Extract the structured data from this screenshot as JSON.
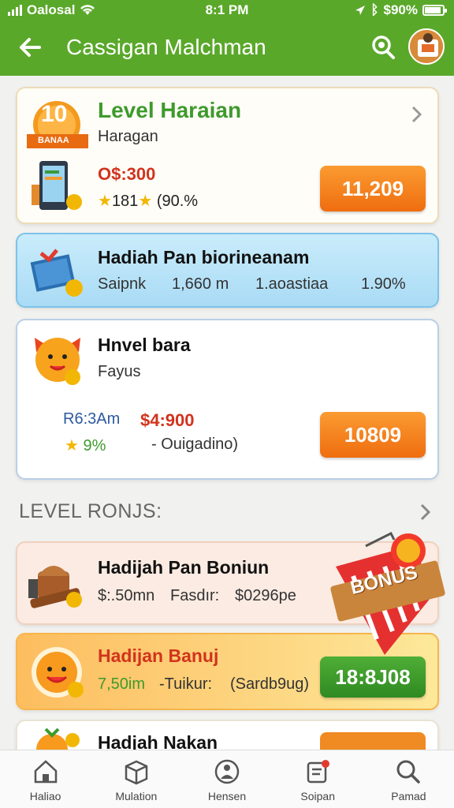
{
  "status": {
    "carrier": "Oalosal",
    "time": "8:1 PM",
    "battery": "$90%"
  },
  "header": {
    "title": "Cassigan Malchman"
  },
  "card1": {
    "badge_num": "10",
    "badge_text": "BANAA",
    "title": "Level Haraian",
    "subtitle": "Haragan",
    "price": "O$:300",
    "rating": "181",
    "rating_pct": "(90.%",
    "button": "11,209"
  },
  "card2": {
    "title": "Hadiah Pan biorineanam",
    "col1": "Saipnk",
    "col2": "1,660 m",
    "col3": "1.aoastiaa",
    "col4": "1.90%"
  },
  "card3": {
    "title": "Hnvel bara",
    "subtitle": "Fayus",
    "left_label": "R6:3Am",
    "price": "$4:900",
    "pct": "9%",
    "note": "- Ouigadino)",
    "button": "10809"
  },
  "section": {
    "label": "LEVEL RONJS:"
  },
  "card4": {
    "title": "Hadijah Pan Boniun",
    "a": "$:.50mn",
    "b": "Fasdır:",
    "c": "$0296pe"
  },
  "card5": {
    "title": "Hadijan Banuj",
    "a": "7,50im",
    "b": "-Tuikur:",
    "c": "(Sardb9ug)",
    "button": "18:8J08"
  },
  "card6": {
    "title": "Hadjah Nakan"
  },
  "sticker": {
    "text": "BONUS"
  },
  "nav": {
    "items": [
      {
        "label": "Haliao"
      },
      {
        "label": "Mulation"
      },
      {
        "label": "Hensen"
      },
      {
        "label": "Soipan"
      },
      {
        "label": "Pamad"
      }
    ]
  },
  "colors": {
    "header": "#5aa82a",
    "accent_orange": "#ef6d0f",
    "accent_green": "#3e9a2d"
  }
}
